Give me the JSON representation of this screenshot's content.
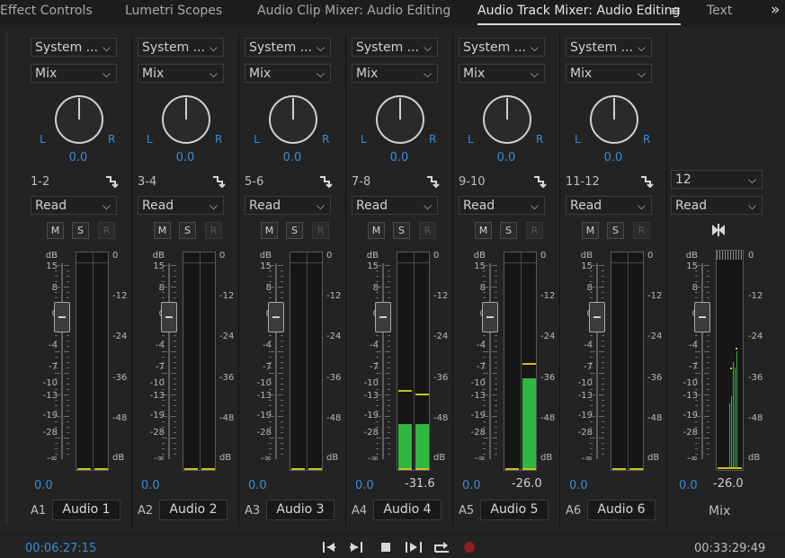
{
  "tabs": [
    {
      "label": "Effect Controls"
    },
    {
      "label": "Lumetri Scopes"
    },
    {
      "label": "Audio Clip Mixer: Audio Editing"
    },
    {
      "label": "Audio Track Mixer: Audio Editing",
      "active": true
    },
    {
      "label": "Text"
    }
  ],
  "colors": {
    "accent": "#3a8bd6",
    "meter_green": "#2fb83f",
    "peak_yellow": "#c9c21c"
  },
  "fader_scale": [
    "dB",
    "15",
    "8",
    "0",
    "-4",
    "-7",
    "-10",
    "-13",
    "-19",
    "-28",
    "-∞"
  ],
  "meter_scale": [
    "0",
    "-12",
    "-24",
    "-36",
    "-48",
    "dB"
  ],
  "channels": [
    {
      "input": "System ...",
      "mode": "Mix",
      "pan": "0.0",
      "pan_l": "L",
      "pan_r": "R",
      "channels": "1-2",
      "automation": "Read",
      "m": "M",
      "s": "S",
      "r": "R",
      "volume": "0.0",
      "peak_readout": "",
      "track_id": "A1",
      "name": "Audio 1",
      "level_l": 0,
      "level_r": 0,
      "peak_l": null,
      "peak_r": null
    },
    {
      "input": "System ...",
      "mode": "Mix",
      "pan": "0.0",
      "pan_l": "L",
      "pan_r": "R",
      "channels": "3-4",
      "automation": "Read",
      "m": "M",
      "s": "S",
      "r": "R",
      "volume": "0.0",
      "peak_readout": "",
      "track_id": "A2",
      "name": "Audio 2",
      "level_l": 0,
      "level_r": 0,
      "peak_l": null,
      "peak_r": null
    },
    {
      "input": "System ...",
      "mode": "Mix",
      "pan": "0.0",
      "pan_l": "L",
      "pan_r": "R",
      "channels": "5-6",
      "automation": "Read",
      "m": "M",
      "s": "S",
      "r": "R",
      "volume": "0.0",
      "peak_readout": "",
      "track_id": "A3",
      "name": "Audio 3",
      "level_l": 0,
      "level_r": 0,
      "peak_l": null,
      "peak_r": null
    },
    {
      "input": "System ...",
      "mode": "Mix",
      "pan": "0.0",
      "pan_l": "L",
      "pan_r": "R",
      "channels": "7-8",
      "automation": "Read",
      "m": "M",
      "s": "S",
      "r": "R",
      "volume": "0.0",
      "peak_readout": "-31.6",
      "track_id": "A4",
      "name": "Audio 4",
      "level_l": -42,
      "level_r": -42,
      "peak_l": -33,
      "peak_r": -34
    },
    {
      "input": "System ...",
      "mode": "Mix",
      "pan": "0.0",
      "pan_l": "L",
      "pan_r": "R",
      "channels": "9-10",
      "automation": "Read",
      "m": "M",
      "s": "S",
      "r": "R",
      "volume": "0.0",
      "peak_readout": "-26.0",
      "track_id": "A5",
      "name": "Audio 5",
      "level_l": null,
      "level_r": -30,
      "peak_l": null,
      "peak_r": -26
    },
    {
      "input": "System ...",
      "mode": "Mix",
      "pan": "0.0",
      "pan_l": "L",
      "pan_r": "R",
      "channels": "11-12",
      "automation": "Read",
      "m": "M",
      "s": "S",
      "r": "R",
      "volume": "0.0",
      "peak_readout": "",
      "track_id": "A6",
      "name": "Audio 6",
      "level_l": 0,
      "level_r": 0,
      "peak_l": null,
      "peak_r": null
    }
  ],
  "master": {
    "output": "12",
    "automation": "Read",
    "volume": "0.0",
    "peak_readout": "-26.0",
    "label": "Mix"
  },
  "bottom": {
    "timecode_current": "00:06:27:15",
    "timecode_duration": "00:33:29:49"
  }
}
